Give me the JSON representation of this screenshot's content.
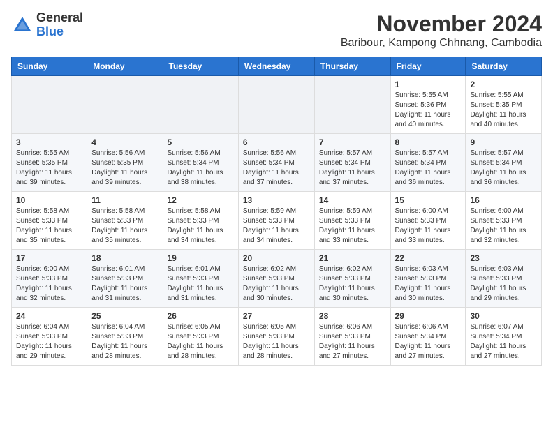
{
  "header": {
    "logo_general": "General",
    "logo_blue": "Blue",
    "month_title": "November 2024",
    "location": "Baribour, Kampong Chhnang, Cambodia"
  },
  "weekdays": [
    "Sunday",
    "Monday",
    "Tuesday",
    "Wednesday",
    "Thursday",
    "Friday",
    "Saturday"
  ],
  "weeks": [
    [
      {
        "day": "",
        "info": ""
      },
      {
        "day": "",
        "info": ""
      },
      {
        "day": "",
        "info": ""
      },
      {
        "day": "",
        "info": ""
      },
      {
        "day": "",
        "info": ""
      },
      {
        "day": "1",
        "info": "Sunrise: 5:55 AM\nSunset: 5:36 PM\nDaylight: 11 hours\nand 40 minutes."
      },
      {
        "day": "2",
        "info": "Sunrise: 5:55 AM\nSunset: 5:35 PM\nDaylight: 11 hours\nand 40 minutes."
      }
    ],
    [
      {
        "day": "3",
        "info": "Sunrise: 5:55 AM\nSunset: 5:35 PM\nDaylight: 11 hours\nand 39 minutes."
      },
      {
        "day": "4",
        "info": "Sunrise: 5:56 AM\nSunset: 5:35 PM\nDaylight: 11 hours\nand 39 minutes."
      },
      {
        "day": "5",
        "info": "Sunrise: 5:56 AM\nSunset: 5:34 PM\nDaylight: 11 hours\nand 38 minutes."
      },
      {
        "day": "6",
        "info": "Sunrise: 5:56 AM\nSunset: 5:34 PM\nDaylight: 11 hours\nand 37 minutes."
      },
      {
        "day": "7",
        "info": "Sunrise: 5:57 AM\nSunset: 5:34 PM\nDaylight: 11 hours\nand 37 minutes."
      },
      {
        "day": "8",
        "info": "Sunrise: 5:57 AM\nSunset: 5:34 PM\nDaylight: 11 hours\nand 36 minutes."
      },
      {
        "day": "9",
        "info": "Sunrise: 5:57 AM\nSunset: 5:34 PM\nDaylight: 11 hours\nand 36 minutes."
      }
    ],
    [
      {
        "day": "10",
        "info": "Sunrise: 5:58 AM\nSunset: 5:33 PM\nDaylight: 11 hours\nand 35 minutes."
      },
      {
        "day": "11",
        "info": "Sunrise: 5:58 AM\nSunset: 5:33 PM\nDaylight: 11 hours\nand 35 minutes."
      },
      {
        "day": "12",
        "info": "Sunrise: 5:58 AM\nSunset: 5:33 PM\nDaylight: 11 hours\nand 34 minutes."
      },
      {
        "day": "13",
        "info": "Sunrise: 5:59 AM\nSunset: 5:33 PM\nDaylight: 11 hours\nand 34 minutes."
      },
      {
        "day": "14",
        "info": "Sunrise: 5:59 AM\nSunset: 5:33 PM\nDaylight: 11 hours\nand 33 minutes."
      },
      {
        "day": "15",
        "info": "Sunrise: 6:00 AM\nSunset: 5:33 PM\nDaylight: 11 hours\nand 33 minutes."
      },
      {
        "day": "16",
        "info": "Sunrise: 6:00 AM\nSunset: 5:33 PM\nDaylight: 11 hours\nand 32 minutes."
      }
    ],
    [
      {
        "day": "17",
        "info": "Sunrise: 6:00 AM\nSunset: 5:33 PM\nDaylight: 11 hours\nand 32 minutes."
      },
      {
        "day": "18",
        "info": "Sunrise: 6:01 AM\nSunset: 5:33 PM\nDaylight: 11 hours\nand 31 minutes."
      },
      {
        "day": "19",
        "info": "Sunrise: 6:01 AM\nSunset: 5:33 PM\nDaylight: 11 hours\nand 31 minutes."
      },
      {
        "day": "20",
        "info": "Sunrise: 6:02 AM\nSunset: 5:33 PM\nDaylight: 11 hours\nand 30 minutes."
      },
      {
        "day": "21",
        "info": "Sunrise: 6:02 AM\nSunset: 5:33 PM\nDaylight: 11 hours\nand 30 minutes."
      },
      {
        "day": "22",
        "info": "Sunrise: 6:03 AM\nSunset: 5:33 PM\nDaylight: 11 hours\nand 30 minutes."
      },
      {
        "day": "23",
        "info": "Sunrise: 6:03 AM\nSunset: 5:33 PM\nDaylight: 11 hours\nand 29 minutes."
      }
    ],
    [
      {
        "day": "24",
        "info": "Sunrise: 6:04 AM\nSunset: 5:33 PM\nDaylight: 11 hours\nand 29 minutes."
      },
      {
        "day": "25",
        "info": "Sunrise: 6:04 AM\nSunset: 5:33 PM\nDaylight: 11 hours\nand 28 minutes."
      },
      {
        "day": "26",
        "info": "Sunrise: 6:05 AM\nSunset: 5:33 PM\nDaylight: 11 hours\nand 28 minutes."
      },
      {
        "day": "27",
        "info": "Sunrise: 6:05 AM\nSunset: 5:33 PM\nDaylight: 11 hours\nand 28 minutes."
      },
      {
        "day": "28",
        "info": "Sunrise: 6:06 AM\nSunset: 5:33 PM\nDaylight: 11 hours\nand 27 minutes."
      },
      {
        "day": "29",
        "info": "Sunrise: 6:06 AM\nSunset: 5:34 PM\nDaylight: 11 hours\nand 27 minutes."
      },
      {
        "day": "30",
        "info": "Sunrise: 6:07 AM\nSunset: 5:34 PM\nDaylight: 11 hours\nand 27 minutes."
      }
    ]
  ]
}
